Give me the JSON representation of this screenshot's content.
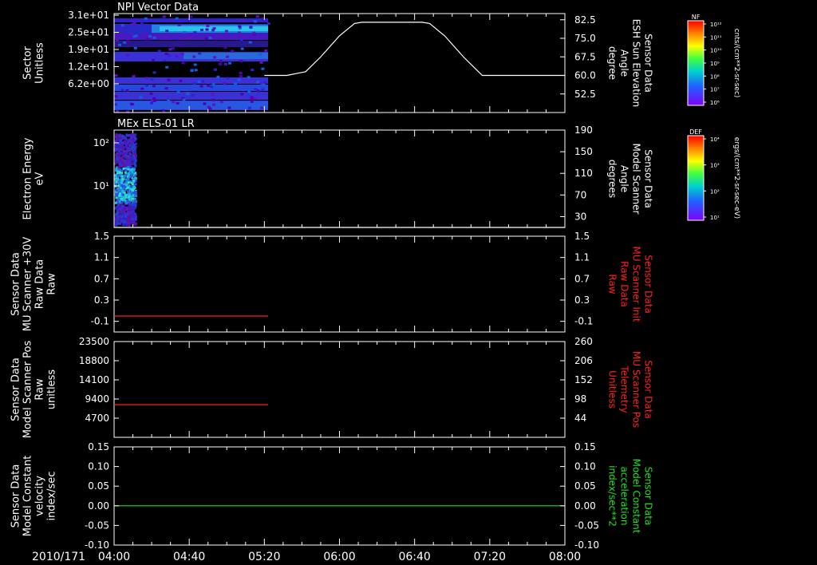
{
  "chart_data": [
    {
      "type": "heatmap",
      "title": "NPI Vector Data",
      "ylabel_left": [
        "Sector",
        "Unitless"
      ],
      "yticks_left": [
        "3.1e+01",
        "2.5e+01",
        "1.9e+01",
        "1.2e+01",
        "6.2e+00"
      ],
      "ylabel_right": [
        "Sensor Data",
        "ESH Sun Elevation",
        "Angle",
        "degree"
      ],
      "yticks_right": [
        "82.5",
        "75.0",
        "67.5",
        "60.0",
        "52.5"
      ],
      "ylim_right": [
        45,
        85
      ],
      "overlay_series": {
        "color": "#ffffff",
        "x": [
          "05:20",
          "05:32",
          "05:42",
          "05:50",
          "06:00",
          "06:08",
          "06:12",
          "06:44",
          "06:48",
          "06:56",
          "07:06",
          "07:16",
          "08:00"
        ],
        "y": [
          60.0,
          60.0,
          61.5,
          67.5,
          76.0,
          81.0,
          81.5,
          81.5,
          81.0,
          76.0,
          67.5,
          60.0,
          60.0
        ]
      },
      "data_extent": [
        "04:00",
        "05:22"
      ],
      "colorbar": {
        "label": "NF",
        "units": "cnts/(cm**2-sr-sec)",
        "tick_labels": [
          "10¹²",
          "10¹¹",
          "10¹⁰",
          "10⁹",
          "10⁸",
          "10⁷",
          "10⁶"
        ]
      }
    },
    {
      "type": "heatmap",
      "title": "MEx ELS-01 LR",
      "ylabel_left": [
        "Electron Energy",
        "eV"
      ],
      "yticks_left": [
        "10²",
        "10¹"
      ],
      "ylabel_right": [
        "Sensor Data",
        "Model Scanner",
        "Angle",
        "degrees"
      ],
      "yticks_right": [
        "190",
        "150",
        "110",
        "70",
        "30"
      ],
      "ylim_right": [
        10,
        190
      ],
      "overlay_series": {
        "color": "#ffffff",
        "x": [
          "04:00",
          "08:00"
        ],
        "y": [
          10,
          10
        ]
      },
      "data_extent": [
        "04:00",
        "04:12"
      ],
      "colorbar": {
        "label": "DEF",
        "units": "ergs/(cm**2-sr-sec-eV)",
        "tick_labels": [
          "10⁴",
          "10³",
          "10²",
          "10¹"
        ]
      }
    },
    {
      "type": "line",
      "ylabel_left": [
        "Sensor Data",
        "MU Scanner +30V",
        "Raw Data",
        "Raw"
      ],
      "yticks_left": [
        "1.5",
        "1.1",
        "0.7",
        "0.3",
        "-0.1"
      ],
      "ylim": [
        -0.3,
        1.5
      ],
      "ylabel_right": [
        "Sensor Data",
        "MU Scanner Init",
        "Raw Data",
        "Raw"
      ],
      "yticks_right": [
        "1.5",
        "1.1",
        "0.7",
        "0.3",
        "-0.1"
      ],
      "right_color": "#ff2020",
      "series": [
        {
          "color": "#ff2020",
          "x": [
            "04:00",
            "05:22"
          ],
          "y": [
            0.0,
            0.0
          ]
        }
      ]
    },
    {
      "type": "line",
      "ylabel_left": [
        "Sensor Data",
        "Model Scanner Pos",
        "Raw",
        "unitless"
      ],
      "yticks_left": [
        "23500",
        "18800",
        "14100",
        "9400",
        "4700"
      ],
      "ylim": [
        0,
        23500
      ],
      "ylabel_right": [
        "Sensor Data",
        "MU Scanner Pos",
        "Telemetry",
        "Unitless"
      ],
      "yticks_right": [
        "260",
        "206",
        "152",
        "98",
        "44"
      ],
      "right_color": "#ff2020",
      "series": [
        {
          "color": "#ff2020",
          "x": [
            "04:00",
            "05:22"
          ],
          "y": [
            8000,
            8000
          ]
        }
      ]
    },
    {
      "type": "line",
      "ylabel_left": [
        "Sensor Data",
        "Model Constant",
        "velocity",
        "index/sec"
      ],
      "yticks_left": [
        "0.15",
        "0.10",
        "0.05",
        "0.00",
        "-0.05",
        "-0.10"
      ],
      "ylim": [
        -0.1,
        0.15
      ],
      "ylabel_right": [
        "Sensor Data",
        "Model Constant",
        "acceleration",
        "index/sec**2"
      ],
      "yticks_right": [
        "0.15",
        "0.10",
        "0.05",
        "0.00",
        "-0.05",
        "-0.10"
      ],
      "right_color": "#20e020",
      "series": [
        {
          "color": "#20e020",
          "x": [
            "04:00",
            "08:00"
          ],
          "y": [
            0.0,
            0.0
          ]
        }
      ]
    }
  ],
  "x_axis": {
    "date_label": "2010/171",
    "tick_labels": [
      "04:00",
      "04:40",
      "05:20",
      "06:00",
      "06:40",
      "07:20",
      "08:00"
    ],
    "range": [
      "04:00",
      "08:00"
    ]
  },
  "colors": {
    "background": "#000000",
    "axes": "#ffffff"
  }
}
